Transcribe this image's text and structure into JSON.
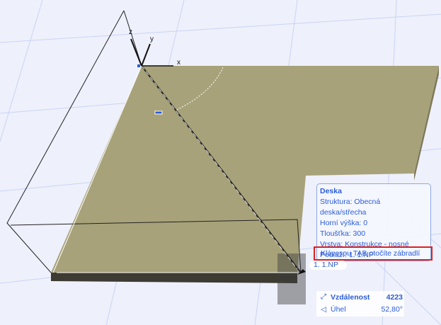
{
  "axes": {
    "x": "x",
    "y": "y",
    "z": "z"
  },
  "tooltip": {
    "title": "Deska",
    "lines": [
      "Struktura: Obecná deska/střecha",
      "Horní výška: 0",
      "Tloušťka: 300",
      "Vrstva: Konstrukce - nosné",
      "Podlaží: 1. 1.NP"
    ],
    "hint": "Klávesou TAB otočíte zábradlí"
  },
  "floor_label": "1. 1.NP",
  "measure": {
    "distance_label": "Vzdálenost",
    "distance_value": "4223",
    "angle_label": "Úhel",
    "angle_value": "52,80°"
  },
  "colors": {
    "slab": "#9e9870",
    "accent": "#2a5cd6",
    "highlight": "#e02020"
  }
}
